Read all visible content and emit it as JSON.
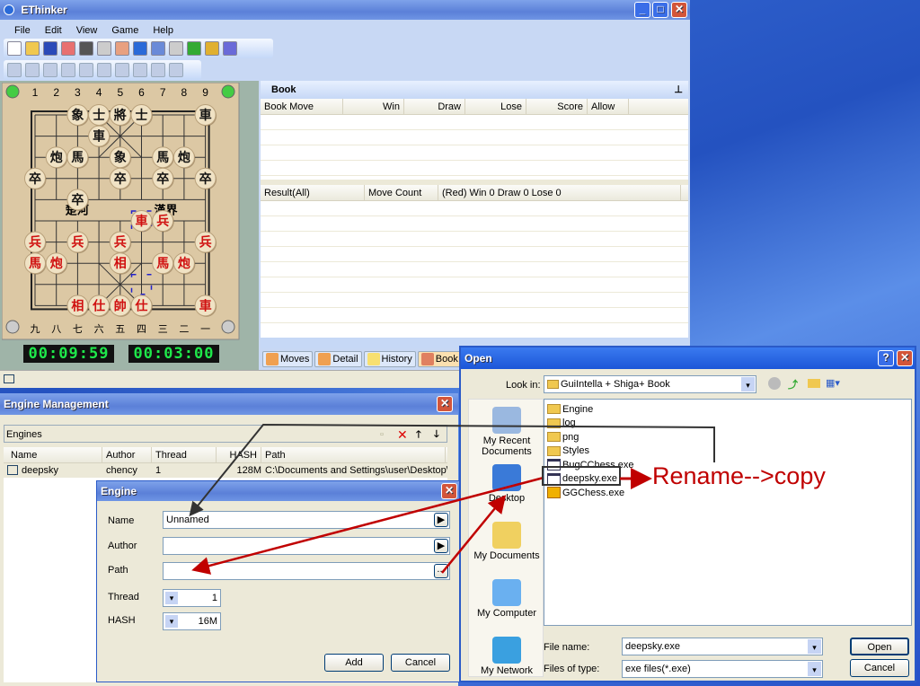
{
  "app": {
    "title": "EThinker",
    "menu": [
      "File",
      "Edit",
      "View",
      "Game",
      "Help"
    ]
  },
  "board": {
    "top_files": [
      "1",
      "2",
      "3",
      "4",
      "5",
      "6",
      "7",
      "8",
      "9"
    ],
    "bottom_files": [
      "九",
      "八",
      "七",
      "六",
      "五",
      "四",
      "三",
      "二",
      "一"
    ],
    "river_left": "楚河",
    "river_right": "漢界",
    "pieces": [
      {
        "c": "象",
        "s": "black",
        "col": 3,
        "row": 0
      },
      {
        "c": "士",
        "s": "black",
        "col": 4,
        "row": 0
      },
      {
        "c": "將",
        "s": "black",
        "col": 5,
        "row": 0
      },
      {
        "c": "士",
        "s": "black",
        "col": 6,
        "row": 0
      },
      {
        "c": "車",
        "s": "black",
        "col": 9,
        "row": 0
      },
      {
        "c": "車",
        "s": "black",
        "col": 4,
        "row": 1
      },
      {
        "c": "炮",
        "s": "black",
        "col": 2,
        "row": 2
      },
      {
        "c": "馬",
        "s": "black",
        "col": 3,
        "row": 2
      },
      {
        "c": "象",
        "s": "black",
        "col": 5,
        "row": 2
      },
      {
        "c": "馬",
        "s": "black",
        "col": 7,
        "row": 2
      },
      {
        "c": "炮",
        "s": "black",
        "col": 8,
        "row": 2
      },
      {
        "c": "卒",
        "s": "black",
        "col": 1,
        "row": 3
      },
      {
        "c": "卒",
        "s": "black",
        "col": 5,
        "row": 3
      },
      {
        "c": "卒",
        "s": "black",
        "col": 7,
        "row": 3
      },
      {
        "c": "卒",
        "s": "black",
        "col": 9,
        "row": 3
      },
      {
        "c": "卒",
        "s": "black",
        "col": 3,
        "row": 4
      },
      {
        "c": "車",
        "s": "red",
        "col": 6,
        "row": 5
      },
      {
        "c": "兵",
        "s": "red",
        "col": 7,
        "row": 5
      },
      {
        "c": "兵",
        "s": "red",
        "col": 1,
        "row": 6
      },
      {
        "c": "兵",
        "s": "red",
        "col": 3,
        "row": 6
      },
      {
        "c": "兵",
        "s": "red",
        "col": 5,
        "row": 6
      },
      {
        "c": "兵",
        "s": "red",
        "col": 9,
        "row": 6
      },
      {
        "c": "馬",
        "s": "red",
        "col": 1,
        "row": 7
      },
      {
        "c": "炮",
        "s": "red",
        "col": 2,
        "row": 7
      },
      {
        "c": "相",
        "s": "red",
        "col": 5,
        "row": 7
      },
      {
        "c": "馬",
        "s": "red",
        "col": 7,
        "row": 7
      },
      {
        "c": "炮",
        "s": "red",
        "col": 8,
        "row": 7
      },
      {
        "c": "相",
        "s": "red",
        "col": 3,
        "row": 9
      },
      {
        "c": "仕",
        "s": "red",
        "col": 4,
        "row": 9
      },
      {
        "c": "帥",
        "s": "red",
        "col": 5,
        "row": 9
      },
      {
        "c": "仕",
        "s": "red",
        "col": 6,
        "row": 9
      },
      {
        "c": "車",
        "s": "red",
        "col": 9,
        "row": 9
      }
    ],
    "last_move": {
      "from": {
        "col": 6,
        "row": 8
      },
      "to": {
        "col": 6,
        "row": 5
      }
    },
    "clock_red": "00:09:59",
    "clock_black": "00:03:00"
  },
  "book": {
    "title": "Book",
    "columns": [
      "Book Move",
      "Win",
      "Draw",
      "Lose",
      "Score",
      "Allow"
    ],
    "result_columns": [
      "Result(All)",
      "Move Count",
      "(Red) Win 0 Draw 0 Lose 0"
    ],
    "tabs": [
      "Moves",
      "Detail",
      "History",
      "Book"
    ],
    "active_tab": "Book"
  },
  "engine_mgmt": {
    "title": "Engine Management",
    "group": "Engines",
    "columns": [
      "Name",
      "Author",
      "Thread",
      "HASH",
      "Path"
    ],
    "rows": [
      {
        "name": "deepsky",
        "author": "chency",
        "thread": "1",
        "hash": "128M",
        "path": "C:\\Documents and Settings\\user\\Desktop\\Ches"
      }
    ]
  },
  "engine_dialog": {
    "title": "Engine",
    "name_label": "Name",
    "name_value": "Unnamed",
    "author_label": "Author",
    "path_label": "Path",
    "browse": "...",
    "thread_label": "Thread",
    "thread_value": "1",
    "hash_label": "HASH",
    "hash_value": "16M",
    "add": "Add",
    "cancel": "Cancel"
  },
  "open_dialog": {
    "title": "Open",
    "look_in_label": "Look in:",
    "look_in": "GuiIntella + Shiga+ Book",
    "places": [
      "My Recent Documents",
      "Desktop",
      "My Documents",
      "My Computer",
      "My Network"
    ],
    "files": [
      {
        "name": "Engine",
        "type": "folder"
      },
      {
        "name": "log",
        "type": "folder"
      },
      {
        "name": "png",
        "type": "folder"
      },
      {
        "name": "Styles",
        "type": "folder"
      },
      {
        "name": "BugCChess.exe",
        "type": "exe"
      },
      {
        "name": "deepsky.exe",
        "type": "exe"
      },
      {
        "name": "GGChess.exe",
        "type": "gexe"
      }
    ],
    "file_name_label": "File name:",
    "file_name": "deepsky.exe",
    "file_type_label": "Files of type:",
    "file_type": "exe files(*.exe)",
    "open": "Open",
    "cancel": "Cancel"
  },
  "annotation": {
    "text": "Rename-->copy",
    "color": "#c00000"
  }
}
